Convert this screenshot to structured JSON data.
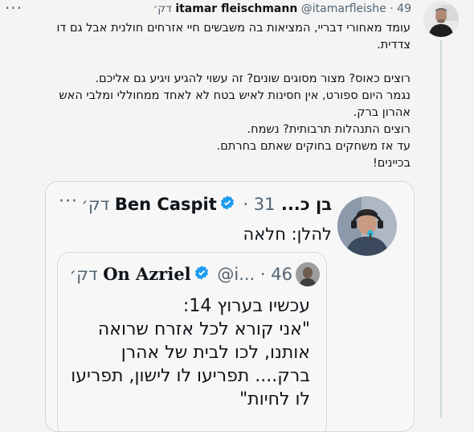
{
  "tweet": {
    "author_name": "itamar fleischmann",
    "author_handle": "@itamarfleishe",
    "time": "49 דק׳",
    "body_lines": [
      "עומד מאחורי דבריי, המציאות בה משבשים חיי אזרחים חולנית אבל גם דו צדדית.",
      "",
      "רוצים כאוס? מצור מסוגים שונים? זה עשוי להגיע ויגיע גם אליכם.",
      "נגמר היום ספורט, אין חסינות לאיש בטח לא לאחד ממחוללי ומלבי האש אהרון ברק.",
      "רוצים התנהלות תרבותית? נשמח.",
      "עד אז משחקים בחוקים שאתם בחרתם.",
      "בכיינים!"
    ]
  },
  "quoted": {
    "author_name": "בן כ... Ben Caspit",
    "time": "31 דק׳",
    "text": "להלן: חלאה"
  },
  "nested": {
    "author_name": "On Azriel",
    "author_handle": "@i...",
    "time": "46 דק׳",
    "lines": [
      "עכשיו בערוץ 14:",
      "\"אני קורא לכל אזרח שרואה",
      "אותנו, לכו לבית של אהרן",
      "ברק.... תפריעו לו לישון, תפריעו",
      "לו לחיות\""
    ]
  },
  "icons": {
    "more": "more-horizontal-icon",
    "verified": "verified-badge-icon"
  },
  "colors": {
    "verified_blue": "#1d9bf0",
    "secondary_text": "#536471"
  }
}
